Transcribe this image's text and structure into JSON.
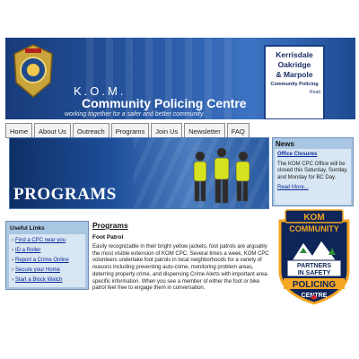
{
  "header": {
    "kom": "K.O.M.",
    "title": "Community Policing Centre",
    "tagline": "working together for a safer and better community.",
    "sign": {
      "line1": "Kerrisdale",
      "line2": "Oakridge",
      "line3": "& Marpole",
      "line4": "Community Policing",
      "line5": "Road"
    }
  },
  "nav": {
    "items": [
      "Home",
      "About Us",
      "Outreach",
      "Programs",
      "Join Us",
      "Newsletter",
      "FAQ"
    ]
  },
  "hero": {
    "title": "PROGRAMS"
  },
  "news": {
    "title": "News",
    "closure_link": "Office Closures",
    "body": "The KOM CPC Office will be closed this Saturday, Sunday, and Monday for BC Day.",
    "more_link": "Read More..."
  },
  "useful_links": {
    "title": "Useful Links",
    "items": [
      "Find a CPC near you",
      "ID a Roller",
      "Report a Crime Online",
      "Secure your Home",
      "Start a Block Watch"
    ]
  },
  "main": {
    "heading": "Programs",
    "subheading": "Foot Patrol",
    "paragraph": "Easily recognizable in their bright yellow jackets, foot patrols are arguably the most visible extension of KOM CPC. Several times a week, KOM CPC volunteers undertake foot patrols in local neighborhoods for a variety of reasons including preventing auto-crime, monitoring problem areas, deterring property crime, and dispensing Crime Alerts with important area-specific information. When you see a member of either the foot or bike patrol feel free to engage them in conversation."
  },
  "logo": {
    "top": "KOM",
    "community": "COMMUNITY",
    "partners": "PARTNERS",
    "in_safety": "IN SAFETY",
    "policing": "POLICING",
    "centre": "CENTRE"
  },
  "colors": {
    "banner_blue": "#2a5ba8",
    "panel_blue": "#a9c6e3",
    "link_blue": "#0b2a9a",
    "logo_orange": "#f5a623"
  }
}
